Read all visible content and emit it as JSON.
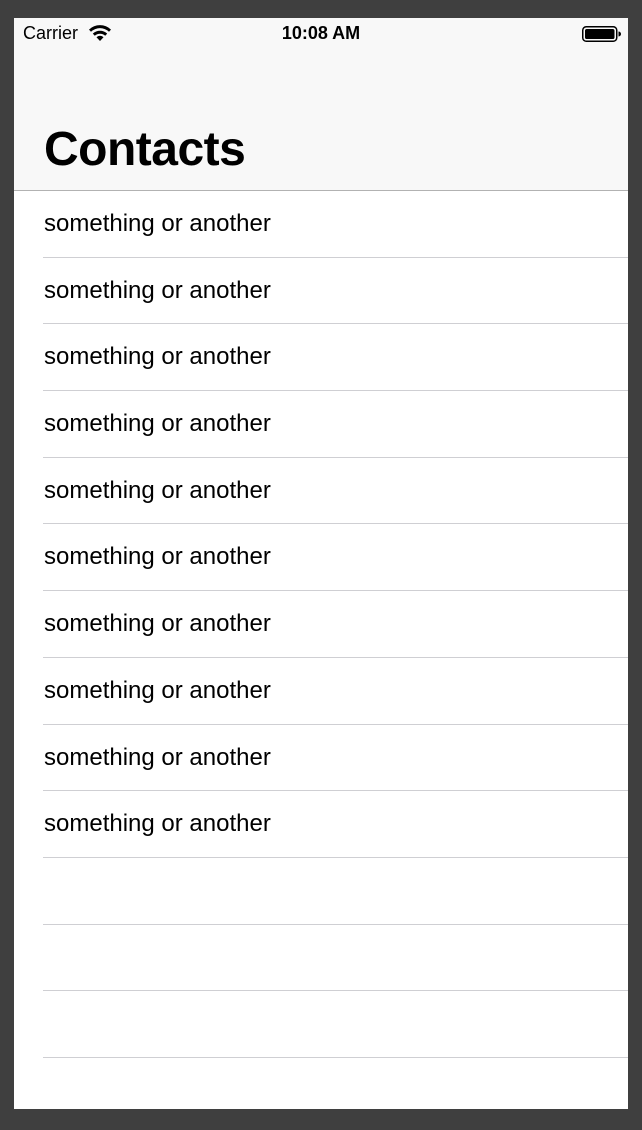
{
  "status_bar": {
    "carrier": "Carrier",
    "time": "10:08 AM",
    "wifi_icon": "wifi-icon",
    "battery_icon": "battery-icon"
  },
  "nav": {
    "title": "Contacts"
  },
  "contacts": {
    "items": [
      "something or another",
      "something or another",
      "something or another",
      "something or another",
      "something or another",
      "something or another",
      "something or another",
      "something or another",
      "something or another",
      "something or another"
    ],
    "empty_rows": 4
  },
  "colors": {
    "background": "#3f3f3f",
    "navbar": "#f8f8f8",
    "separator": "#cfcfd3",
    "text": "#000000"
  }
}
